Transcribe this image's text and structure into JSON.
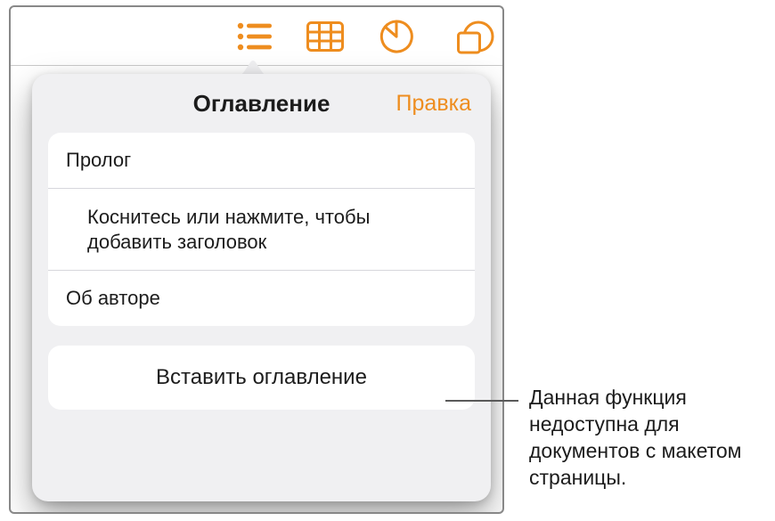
{
  "toolbar": {
    "icons": [
      "list-icon",
      "table-icon",
      "chart-icon",
      "shape-icon"
    ]
  },
  "popover": {
    "title": "Оглавление",
    "edit": "Правка",
    "items": [
      {
        "label": "Пролог",
        "indent": false
      },
      {
        "label": "Коснитесь или нажмите, чтобы добавить заголовок",
        "indent": true
      },
      {
        "label": "Об авторе",
        "indent": false
      }
    ],
    "insert": "Вставить оглавление"
  },
  "callout": "Данная функция недоступна для документов с макетом страницы.",
  "colors": {
    "accent": "#ee8d1f"
  }
}
